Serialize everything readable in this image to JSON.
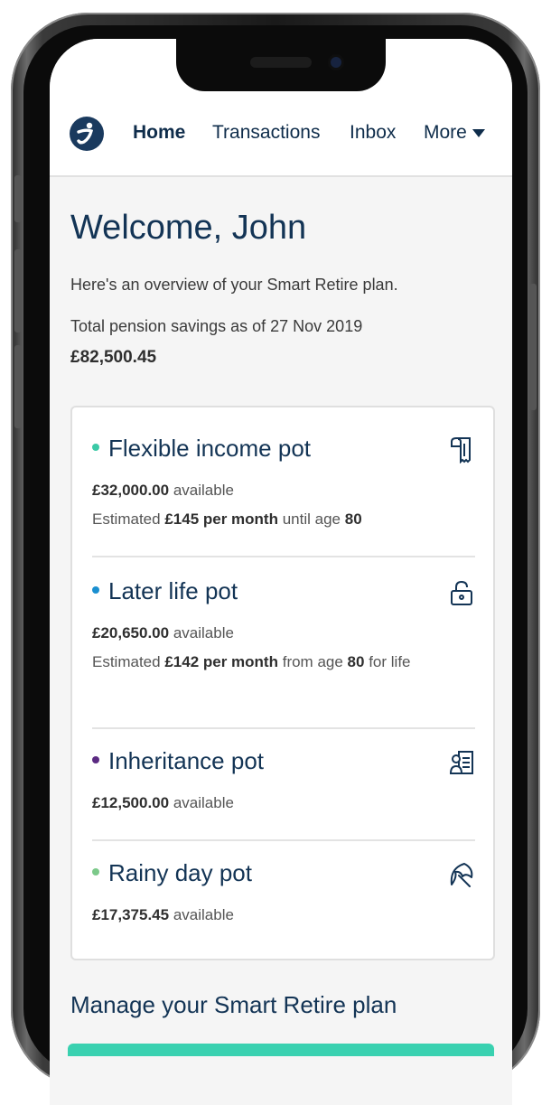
{
  "nav": {
    "home": "Home",
    "transactions": "Transactions",
    "inbox": "Inbox",
    "more": "More"
  },
  "welcome": {
    "title": "Welcome, John",
    "intro": "Here's an overview of your Smart Retire plan.",
    "total_label": "Total pension savings as of 27 Nov 2019",
    "total_value": "£82,500.45"
  },
  "pots": [
    {
      "name": "Flexible income pot",
      "dot_color": "#3bc9a6",
      "amount": "£32,000.00",
      "available": "available",
      "est_prefix": "Estimated",
      "est_amount": "£145 per month",
      "est_mid": "until age",
      "est_age": "80",
      "icon": "receipt-icon"
    },
    {
      "name": "Later life pot",
      "dot_color": "#1a8fd0",
      "amount": "£20,650.00",
      "available": "available",
      "est_prefix": "Estimated",
      "est_amount": "£142 per month",
      "est_mid": "from age",
      "est_age": "80",
      "est_suffix": "for",
      "est_wrap": "life",
      "icon": "lock-icon"
    },
    {
      "name": "Inheritance pot",
      "dot_color": "#5b2a82",
      "amount": "£12,500.00",
      "available": "available",
      "icon": "will-document-icon"
    },
    {
      "name": "Rainy day pot",
      "dot_color": "#7cc98a",
      "amount": "£17,375.45",
      "available": "available",
      "icon": "umbrella-icon"
    }
  ],
  "manage": {
    "title": "Manage your Smart Retire plan"
  },
  "colors": {
    "navy": "#133455",
    "accent": "#39d1b0"
  }
}
